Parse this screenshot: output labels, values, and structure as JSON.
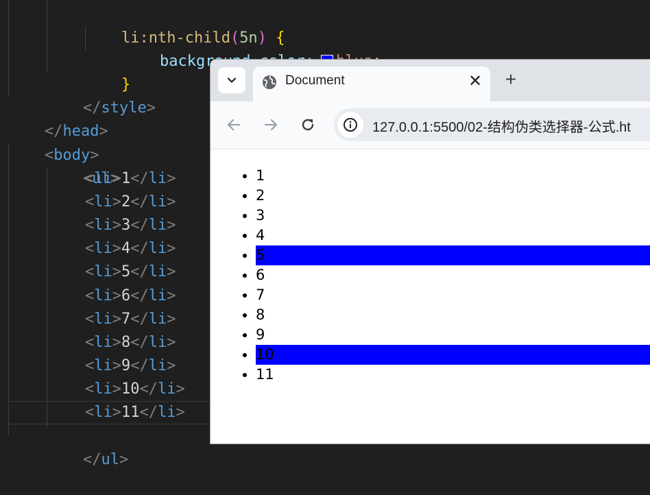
{
  "editor": {
    "selector": "li:nth-child(5n)",
    "selector_name": "li",
    "pseudo": ":nth-child",
    "pseudo_arg": "5n",
    "open_brace": "{",
    "property": "background-color",
    "colon": ":",
    "value": "blue",
    "semicolon": ";",
    "swatch_color": "#0000ff",
    "close_brace": "}",
    "style_close_tag": "style",
    "head_close_tag": "head",
    "body_tag": "body",
    "ul_tag": "ul",
    "li_tag": "li",
    "items": [
      "1",
      "2",
      "3",
      "4",
      "5",
      "6",
      "7",
      "8",
      "9",
      "10",
      "11"
    ]
  },
  "browser": {
    "tab_title": "Document",
    "close_label": "✕",
    "new_tab_label": "+",
    "url": "127.0.0.1:5500/02-结构伪类选择器-公式.ht"
  },
  "page": {
    "items": [
      "1",
      "2",
      "3",
      "4",
      "5",
      "6",
      "7",
      "8",
      "9",
      "10",
      "11"
    ],
    "highlighted": [
      "5",
      "10"
    ],
    "highlight_color": "#0000ff"
  }
}
